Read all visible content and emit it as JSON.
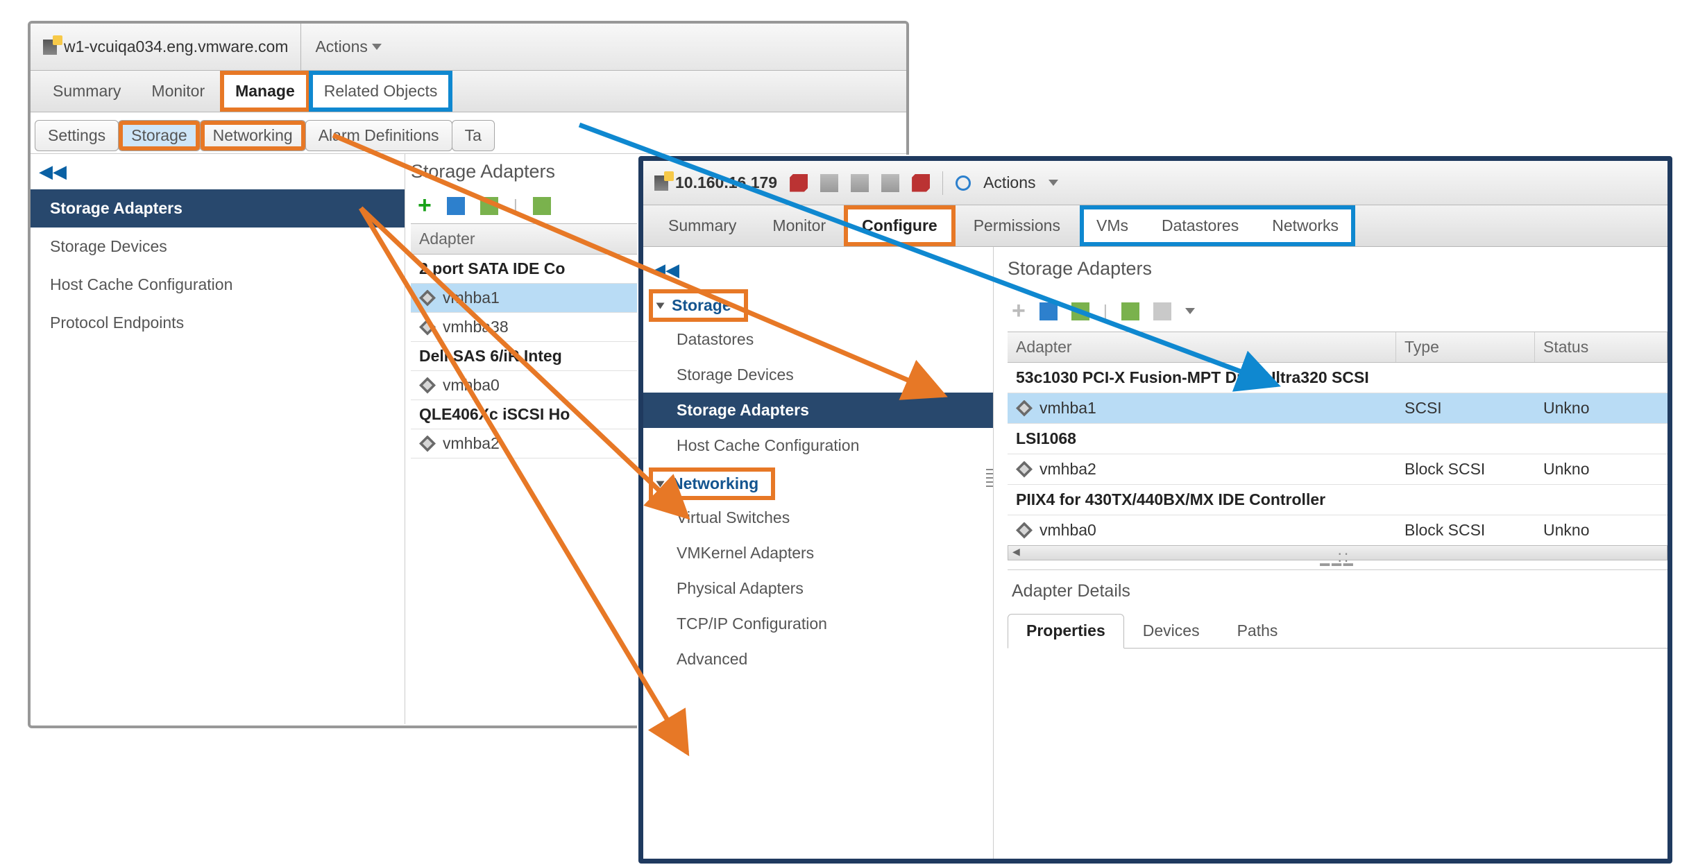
{
  "panelA": {
    "host": "w1-vcuiqa034.eng.vmware.com",
    "actions": "Actions",
    "tabs_main": [
      "Summary",
      "Monitor",
      "Manage",
      "Related Objects"
    ],
    "tabs_sub": [
      "Settings",
      "Storage",
      "Networking",
      "Alarm Definitions",
      "Ta"
    ],
    "sidebar": [
      "Storage Adapters",
      "Storage Devices",
      "Host Cache Configuration",
      "Protocol Endpoints"
    ],
    "main_heading": "Storage Adapters",
    "col_adapter": "Adapter",
    "rows": [
      {
        "group": true,
        "label": "2 port SATA IDE Co"
      },
      {
        "group": false,
        "label": "vmhba1",
        "selected": true
      },
      {
        "group": false,
        "label": "vmhba38"
      },
      {
        "group": true,
        "label": "Dell SAS 6/iR Integ"
      },
      {
        "group": false,
        "label": "vmhba0"
      },
      {
        "group": true,
        "label": "QLE406Xc iSCSI Ho"
      },
      {
        "group": false,
        "label": "vmhba2"
      }
    ]
  },
  "panelB": {
    "host": "10.160.16.179",
    "actions": "Actions",
    "tabs_main": [
      "Summary",
      "Monitor",
      "Configure",
      "Permissions",
      "VMs",
      "Datastores",
      "Networks"
    ],
    "side_sections": {
      "storage": {
        "label": "Storage",
        "items": [
          "Datastores",
          "Storage Devices",
          "Storage Adapters",
          "Host Cache Configuration"
        ],
        "selected_index": 2
      },
      "networking": {
        "label": "Networking",
        "items": [
          "Virtual Switches",
          "VMKernel Adapters",
          "Physical Adapters",
          "TCP/IP Configuration",
          "Advanced"
        ]
      }
    },
    "main_heading": "Storage Adapters",
    "columns": [
      "Adapter",
      "Type",
      "Status"
    ],
    "rows": [
      {
        "group": true,
        "label": "53c1030 PCI-X Fusion-MPT Dual Ultra320 SCSI"
      },
      {
        "group": false,
        "label": "vmhba1",
        "type": "SCSI",
        "status": "Unkno",
        "selected": true
      },
      {
        "group": true,
        "label": "LSI1068"
      },
      {
        "group": false,
        "label": "vmhba2",
        "type": "Block SCSI",
        "status": "Unkno"
      },
      {
        "group": true,
        "label": "PIIX4 for 430TX/440BX/MX IDE Controller"
      },
      {
        "group": false,
        "label": "vmhba0",
        "type": "Block SCSI",
        "status": "Unkno"
      }
    ],
    "details_heading": "Adapter Details",
    "subtabs": [
      "Properties",
      "Devices",
      "Paths"
    ]
  },
  "colors": {
    "orange": "#e77826",
    "blue": "#0f88d0"
  }
}
